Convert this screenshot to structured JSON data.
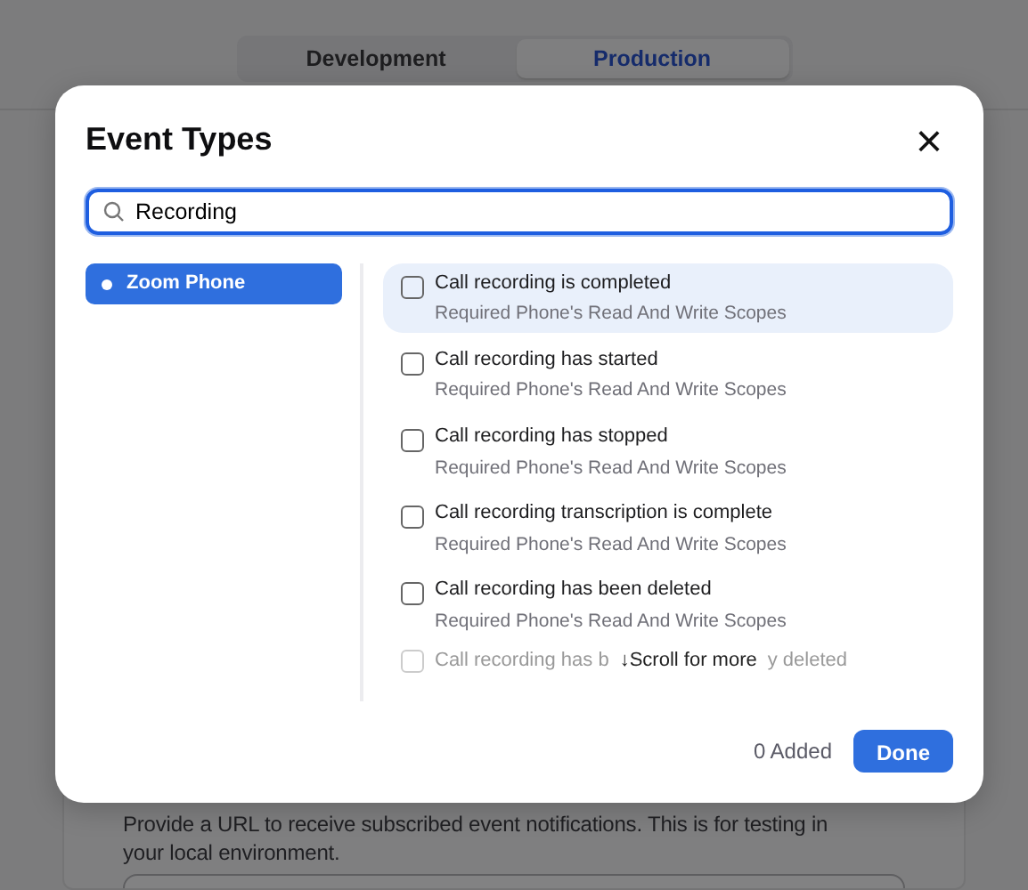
{
  "env_tabs": [
    {
      "label": "Development",
      "selected": false
    },
    {
      "label": "Production",
      "selected": true
    }
  ],
  "modal": {
    "title": "Event Types",
    "close": "×",
    "search": {
      "value": "Recording"
    },
    "categories": [
      {
        "label": "Zoom Phone",
        "selected": true
      }
    ],
    "events": [
      {
        "title": "Call recording is completed",
        "note": "Required Phone's Read And Write Scopes",
        "checked": false,
        "highlighted": true
      },
      {
        "title": "Call recording has started",
        "note": "Required Phone's Read And Write Scopes",
        "checked": false,
        "highlighted": false
      },
      {
        "title": "Call recording has stopped",
        "note": "Required Phone's Read And Write Scopes",
        "checked": false,
        "highlighted": false
      },
      {
        "title": "Call recording transcription is complete",
        "note": "Required Phone's Read And Write Scopes",
        "checked": false,
        "highlighted": false
      },
      {
        "title": "Call recording has been deleted",
        "note": "Required Phone's Read And Write Scopes",
        "checked": false,
        "highlighted": false
      }
    ],
    "faded_event": {
      "title_start": "Call recording has b",
      "title_end": "y deleted",
      "checked": false
    },
    "scroll_hint": {
      "arrow": "↓",
      "text": "Scroll for more"
    },
    "added_count": "0 Added",
    "done": "Done"
  },
  "endpoint": {
    "description": "Provide a URL to receive subscribed event notifications. This is for testing in your local environment."
  }
}
